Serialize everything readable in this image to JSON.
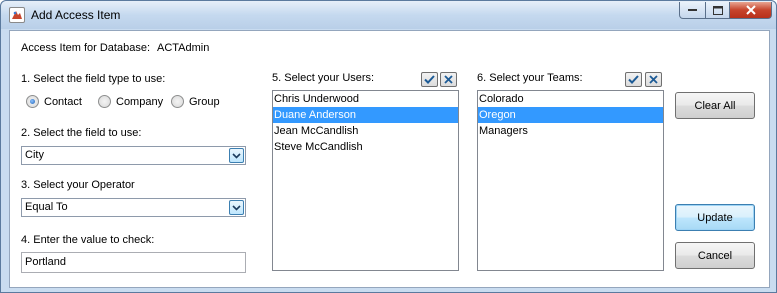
{
  "window": {
    "title": "Add Access Item"
  },
  "header": {
    "db_label": "Access Item for Database:",
    "db_name": "ACTAdmin"
  },
  "step1": {
    "label": "1. Select the field type to use:",
    "options": [
      {
        "label": "Contact",
        "checked": true
      },
      {
        "label": "Company",
        "checked": false
      },
      {
        "label": "Group",
        "checked": false
      }
    ]
  },
  "step2": {
    "label": "2. Select the field to use:",
    "value": "City"
  },
  "step3": {
    "label": "3. Select your Operator",
    "value": "Equal To"
  },
  "step4": {
    "label": "4. Enter the value to check:",
    "value": "Portland"
  },
  "users": {
    "label": "5. Select your Users:",
    "items": [
      {
        "name": "Chris Underwood",
        "selected": false
      },
      {
        "name": "Duane Anderson",
        "selected": true
      },
      {
        "name": "Jean McCandlish",
        "selected": false
      },
      {
        "name": "Steve McCandlish",
        "selected": false
      }
    ]
  },
  "teams": {
    "label": "6. Select your Teams:",
    "items": [
      {
        "name": "Colorado",
        "selected": false
      },
      {
        "name": "Oregon",
        "selected": true
      },
      {
        "name": "Managers",
        "selected": false
      }
    ]
  },
  "buttons": {
    "clear_all": "Clear All",
    "update": "Update",
    "cancel": "Cancel"
  },
  "colors": {
    "selection": "#3399ff",
    "check_icon": "#1d5b96",
    "close_button": "#c7442c"
  }
}
